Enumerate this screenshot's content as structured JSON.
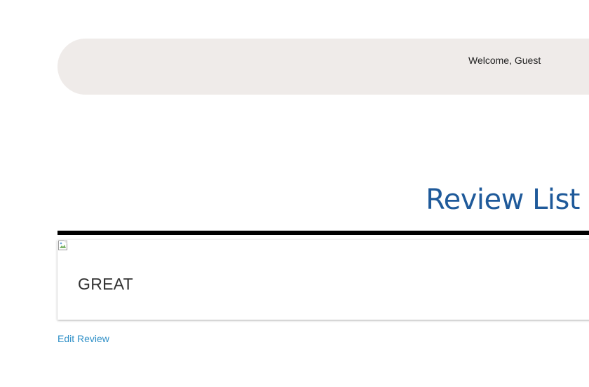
{
  "header": {
    "welcome_text": "Welcome, Guest"
  },
  "main": {
    "title": "Review List",
    "reviews": [
      {
        "image_icon": "broken-image-icon",
        "text": "GREAT",
        "edit_label": "Edit Review"
      }
    ]
  },
  "colors": {
    "header_bar": "#efebe9",
    "title": "#1f5a9a",
    "link": "#2e8fc7",
    "rule": "#000000"
  }
}
